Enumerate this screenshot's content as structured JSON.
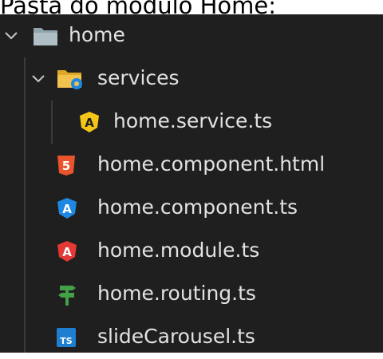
{
  "caption": "Pasta do módulo Home:",
  "tree": {
    "home_folder": {
      "label": "home",
      "expanded": true,
      "icon": "folder-icon",
      "color": "#90a4ae"
    },
    "services_folder": {
      "label": "services",
      "expanded": true,
      "icon": "gear-folder-icon",
      "color": "#f2c14e"
    },
    "files": [
      {
        "label": "home.service.ts",
        "icon": "angular-service-icon",
        "color": "#f5c518"
      },
      {
        "label": "home.component.html",
        "icon": "html5-icon",
        "color": "#e8552d"
      },
      {
        "label": "home.component.ts",
        "icon": "angular-component-icon",
        "color": "#1e88e5"
      },
      {
        "label": "home.module.ts",
        "icon": "angular-module-icon",
        "color": "#e53935"
      },
      {
        "label": "home.routing.ts",
        "icon": "routing-signpost-icon",
        "color": "#43a047"
      },
      {
        "label": "slideCarousel.ts",
        "icon": "typescript-icon",
        "color": "#1e7fd0"
      }
    ]
  }
}
